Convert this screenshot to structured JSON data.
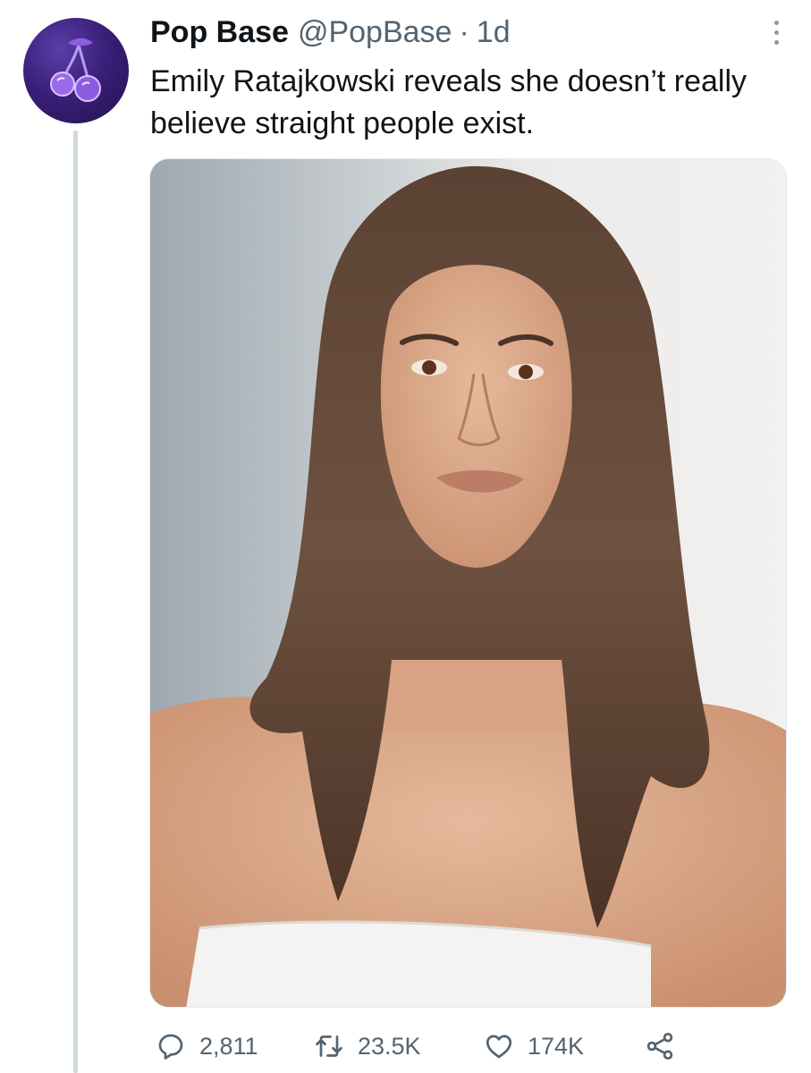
{
  "tweet": {
    "author_name": "Pop Base",
    "author_handle": "@PopBase",
    "separator": "·",
    "time": "1d",
    "text": "Emily Ratajkowski reveals she doesn’t really believe straight people exist."
  },
  "actions": {
    "replies": "2,811",
    "retweets": "23.5K",
    "likes": "174K"
  },
  "icons": {
    "avatar": "cherry-icon",
    "more": "more-vertical-icon",
    "reply": "reply-icon",
    "retweet": "retweet-icon",
    "like": "heart-icon",
    "share": "share-icon"
  },
  "colors": {
    "text": "#0f1419",
    "secondary": "#536471",
    "thread_line": "#cfd9de",
    "avatar_bg": "#3b1f7a"
  }
}
